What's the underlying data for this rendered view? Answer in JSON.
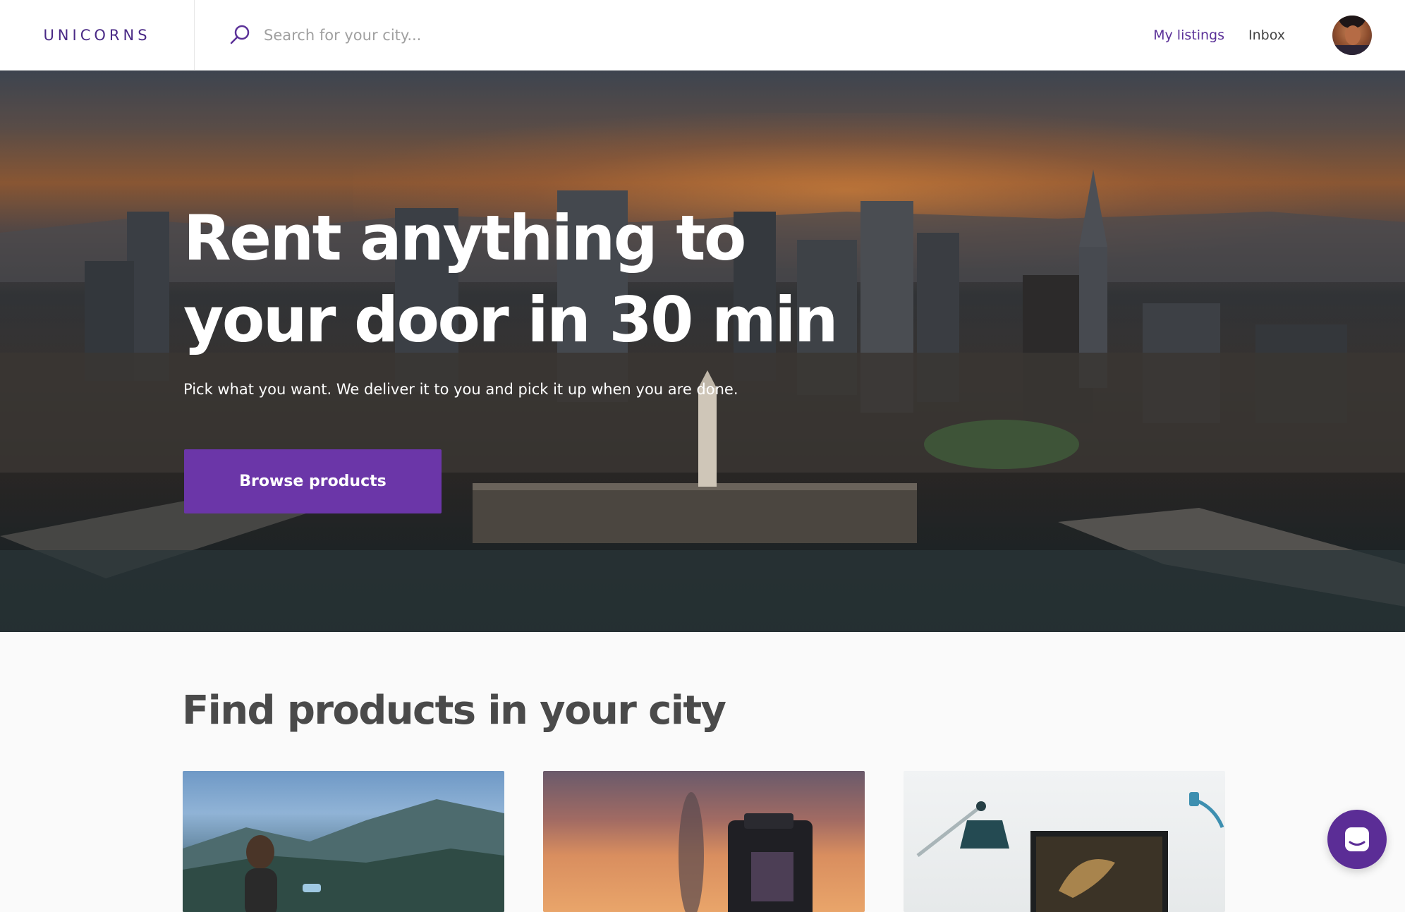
{
  "brand": {
    "logo_text": "UNICORNS",
    "accent": "#6b36a8"
  },
  "header": {
    "search": {
      "placeholder": "Search for your city...",
      "value": "",
      "icon": "search-icon"
    },
    "nav": {
      "my_listings": "My listings",
      "inbox": "Inbox"
    },
    "avatar_icon": "user-avatar"
  },
  "hero": {
    "title": "Rent anything to your door in 30 min",
    "subtitle": "Pick what you want. We deliver it to you and pick it up when you are done.",
    "cta": "Browse products"
  },
  "section": {
    "title": "Find products in your city"
  },
  "chat": {
    "icon": "chat-icon"
  }
}
